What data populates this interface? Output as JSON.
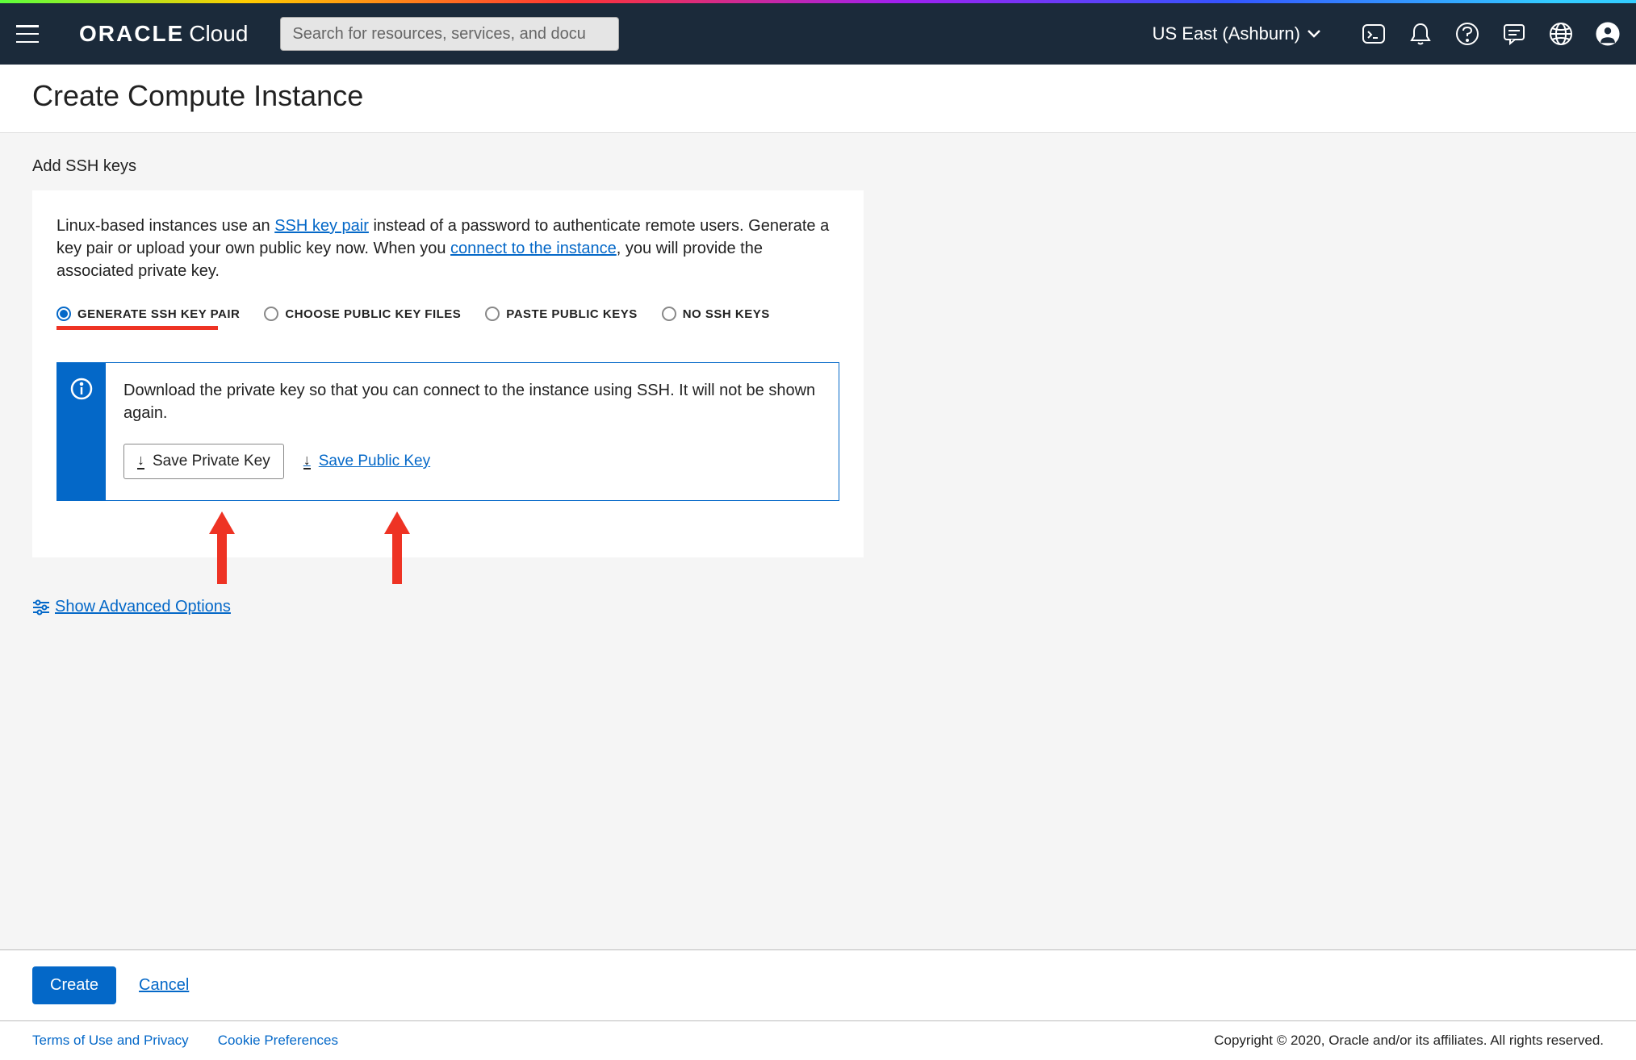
{
  "header": {
    "logo_brand": "ORACLE",
    "logo_product": "Cloud",
    "search_placeholder": "Search for resources, services, and docu",
    "region": "US East (Ashburn)"
  },
  "page": {
    "title": "Create Compute Instance"
  },
  "ssh": {
    "section_label": "Add SSH keys",
    "description_pre": "Linux-based instances use an ",
    "description_link1": "SSH key pair",
    "description_mid": " instead of a password to authenticate remote users. Generate a key pair or upload your own public key now. When you ",
    "description_link2": "connect to the instance",
    "description_post": ", you will provide the associated private key.",
    "options": {
      "generate": "GENERATE SSH KEY PAIR",
      "choose_files": "CHOOSE PUBLIC KEY FILES",
      "paste": "PASTE PUBLIC KEYS",
      "none": "NO SSH KEYS"
    },
    "info_text": "Download the private key so that you can connect to the instance using SSH. It will not be shown again.",
    "save_private": "Save Private Key",
    "save_public": "Save Public Key"
  },
  "advanced_options": "Show Advanced Options",
  "actions": {
    "create": "Create",
    "cancel": "Cancel"
  },
  "footer": {
    "terms": "Terms of Use and Privacy",
    "cookies": "Cookie Preferences",
    "copyright": "Copyright © 2020, Oracle and/or its affiliates. All rights reserved."
  }
}
